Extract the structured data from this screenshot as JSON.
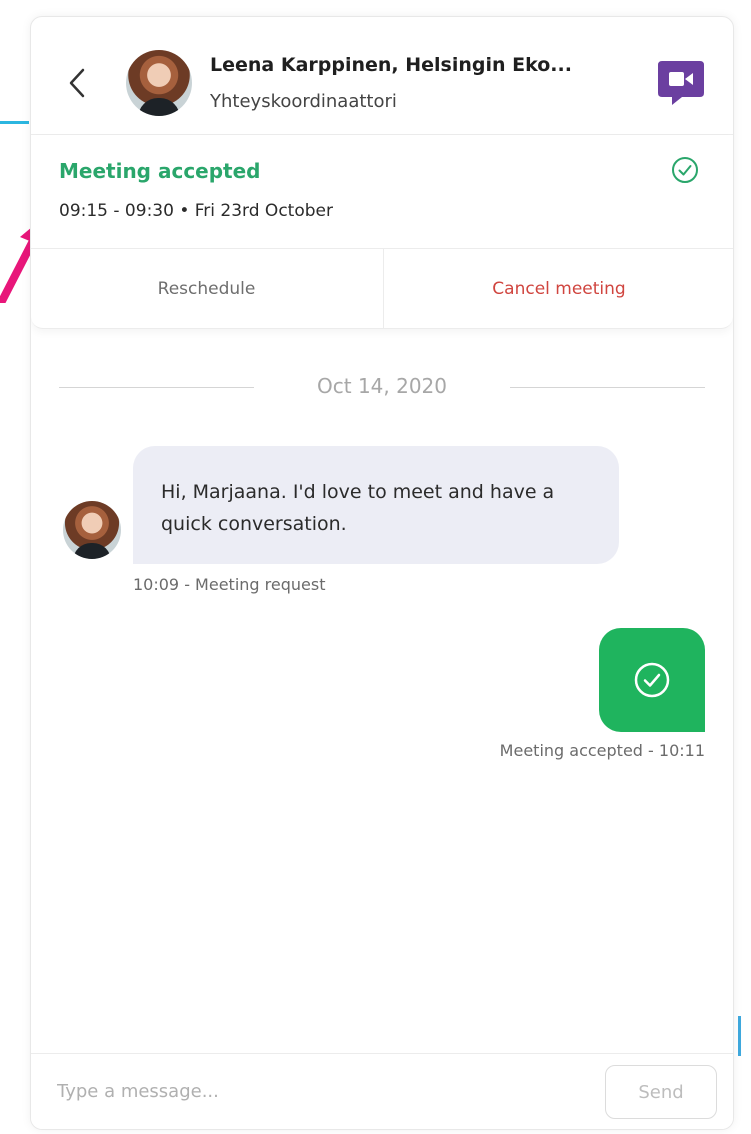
{
  "header": {
    "contact_name": "Leena Karppinen, Helsingin Eko...",
    "contact_role": "Yhteyskoordinaattori"
  },
  "meeting": {
    "status": "Meeting accepted",
    "time": "09:15 - 09:30 • Fri 23rd October",
    "reschedule_label": "Reschedule",
    "cancel_label": "Cancel meeting"
  },
  "chat": {
    "date_separator": "Oct 14, 2020",
    "messages": [
      {
        "text": "Hi, Marjaana. I'd love to meet and have a quick conversation.",
        "meta": "10:09 - Meeting request"
      },
      {
        "meta": "Meeting accepted - 10:11"
      }
    ]
  },
  "composer": {
    "placeholder": "Type a message...",
    "send_label": "Send"
  },
  "colors": {
    "accent_green": "#2aa66b",
    "bubble_green": "#1fb45e",
    "cancel_red": "#d0453f",
    "video_purple": "#6b3fa0",
    "annotation_pink": "#e8167a",
    "annotation_blue": "#2bb6e0"
  },
  "icons": {
    "back": "chevron-left-icon",
    "video": "video-call-icon",
    "status": "check-circle-icon",
    "accepted": "check-circle-icon"
  }
}
